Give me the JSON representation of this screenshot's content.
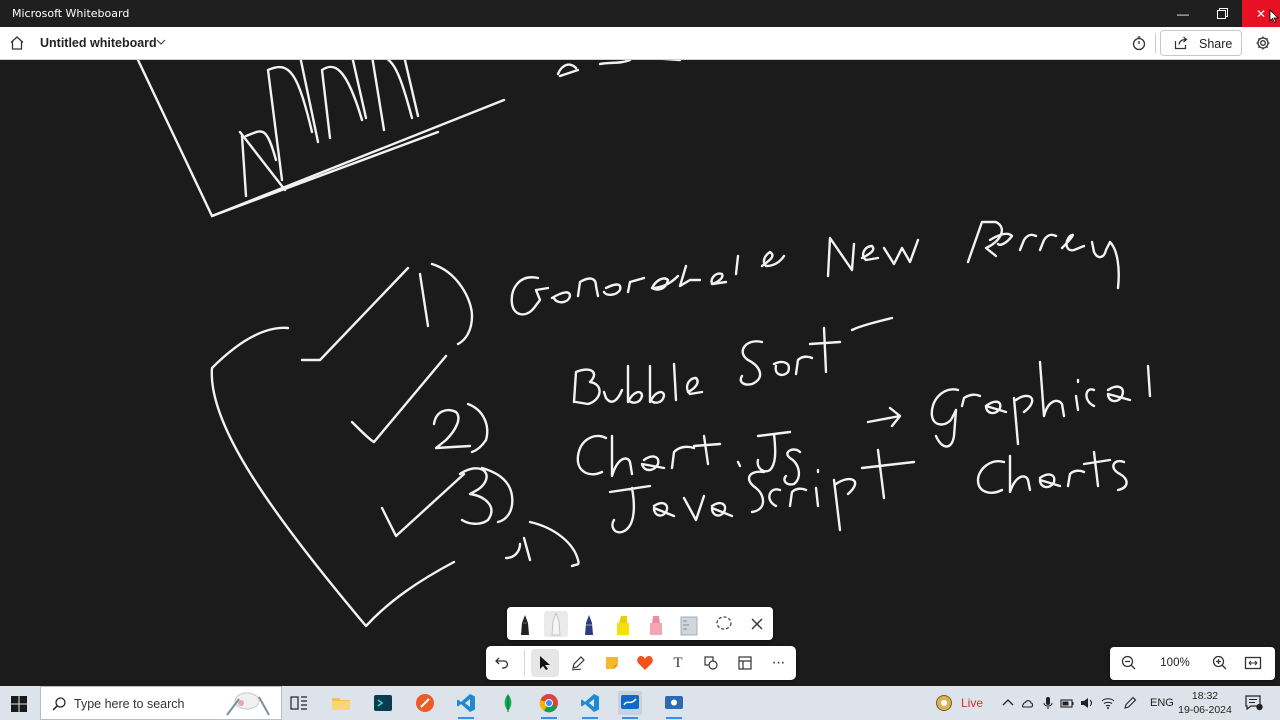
{
  "window": {
    "app_title": "Microsoft Whiteboard",
    "minimize_glyph": "—",
    "maximize_glyph": "❐",
    "close_glyph": "✕"
  },
  "header": {
    "board_title": "Untitled whiteboard",
    "share_label": "Share"
  },
  "canvas": {
    "ink_words": [
      "1)",
      "Generate New Array",
      "2)",
      "Bubble Sort",
      "3)",
      "Chart.Js → Graphical",
      "Javascript Charts",
      "4)"
    ]
  },
  "pen_tray": {
    "pens": [
      {
        "name": "black-pen",
        "color": "#111111"
      },
      {
        "name": "white-pen",
        "color": "#f4f4f4",
        "selected": true
      },
      {
        "name": "blue-pen",
        "color": "#2a3a7a"
      },
      {
        "name": "yellow-highlighter",
        "color": "#f5e10a"
      },
      {
        "name": "pink-highlighter",
        "color": "#f3a7b3"
      },
      {
        "name": "ruler",
        "color": "#cfd6dc"
      }
    ]
  },
  "toolbar": {
    "tools": [
      "undo",
      "select",
      "pen",
      "sticky-note",
      "reactions",
      "text",
      "shapes",
      "templates",
      "more"
    ],
    "more_glyph": "···",
    "text_glyph": "T"
  },
  "zoom": {
    "level": "100%"
  },
  "taskbar": {
    "search_placeholder": "Type here to search",
    "live_label": "Live",
    "language": "ENG",
    "time": "18:32",
    "date": "19-06-2024"
  },
  "colors": {
    "canvas_bg": "#1b1b1b",
    "ink": "#f2f2f2",
    "close_red": "#e81123",
    "taskbar_bg": "#dde3ea",
    "accent": "#3a8ee6"
  }
}
